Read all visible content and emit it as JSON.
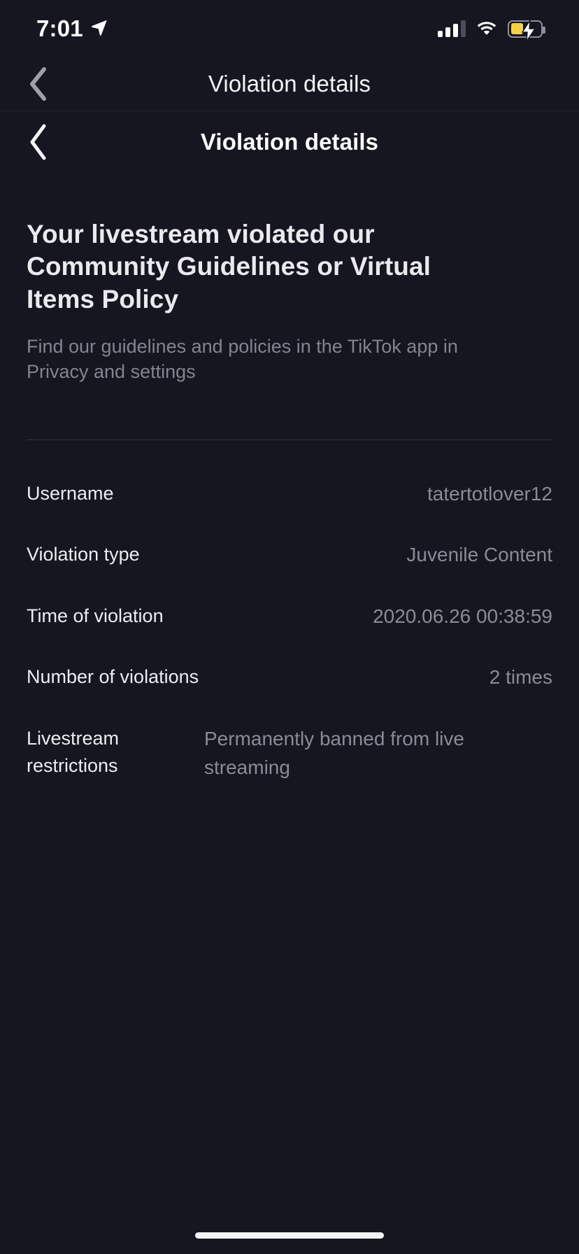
{
  "status_bar": {
    "time": "7:01",
    "location_icon": "location-arrow-icon",
    "signal_icon": "cellular-signal-icon",
    "signal_bars_filled": 3,
    "signal_bars_total": 4,
    "wifi_icon": "wifi-icon",
    "battery_icon": "battery-charging-icon",
    "battery_level_percent": 42,
    "battery_color": "#f5d148"
  },
  "outer_nav": {
    "back_icon": "chevron-left-icon",
    "title": "Violation details"
  },
  "inner_nav": {
    "back_icon": "chevron-left-icon",
    "title": "Violation details"
  },
  "main": {
    "headline": "Your livestream violated our Community Guidelines or Virtual Items Policy",
    "subtext": "Find our guidelines and policies in the TikTok app in Privacy and settings",
    "rows": [
      {
        "label": "Username",
        "value": "tatertotlover12"
      },
      {
        "label": "Violation type",
        "value": "Juvenile Content"
      },
      {
        "label": "Time of violation",
        "value": "2020.06.26 00:38:59"
      },
      {
        "label": "Number of violations",
        "value": "2 times"
      },
      {
        "label": "Livestream restrictions",
        "value": "Permanently banned from live streaming"
      }
    ]
  },
  "colors": {
    "background": "#15161f",
    "primary_text": "#ececf0",
    "secondary_text": "#8a8b96",
    "divider": "#33343f"
  }
}
